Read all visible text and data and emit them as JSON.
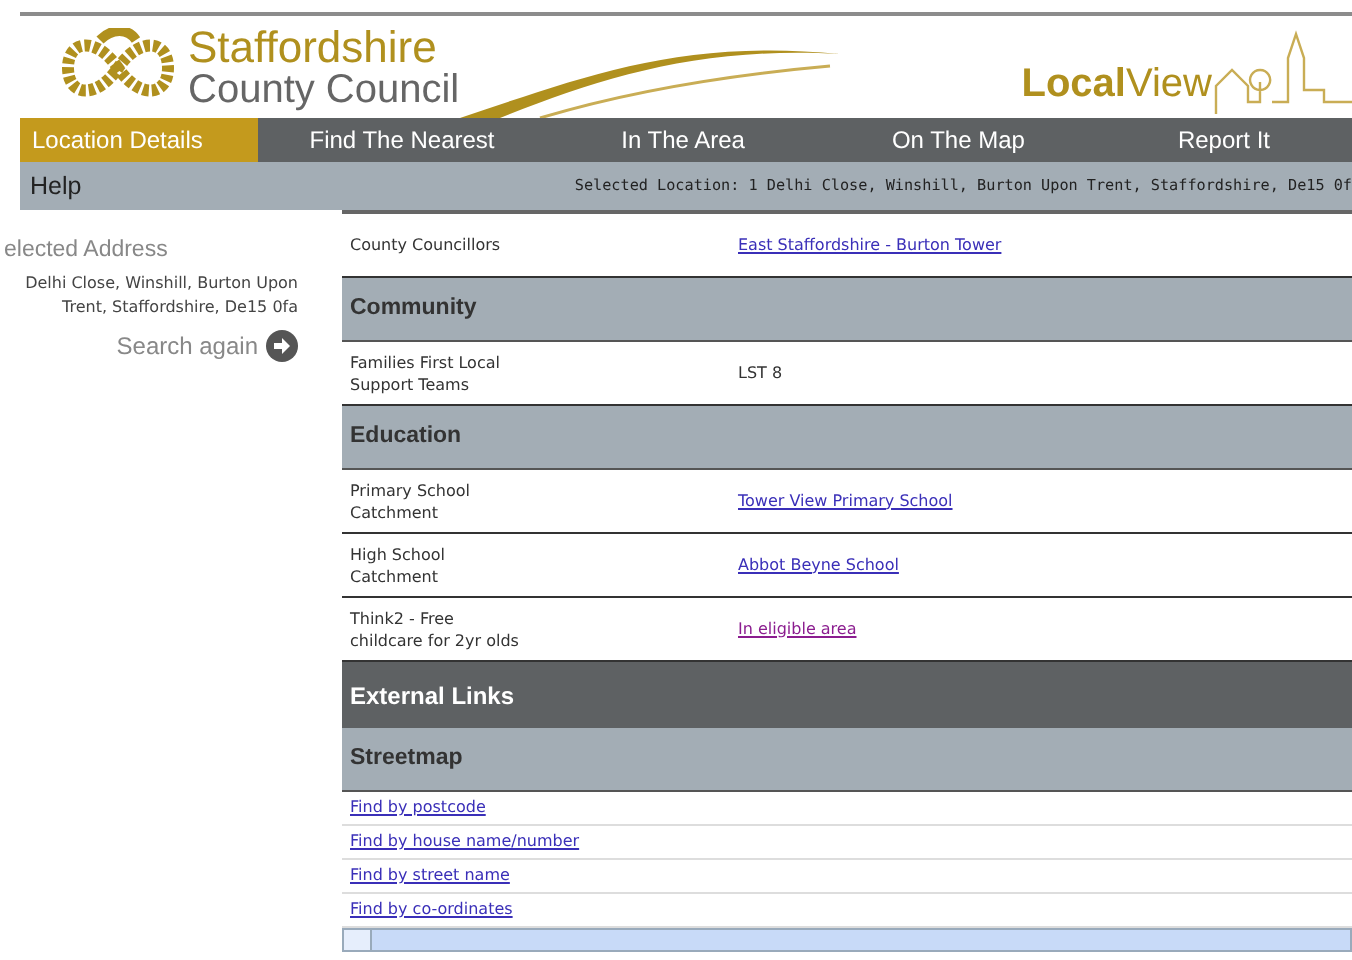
{
  "header": {
    "council_line1": "Staffordshire",
    "council_line2": "County Council",
    "brand_bold": "Local",
    "brand_light": "View"
  },
  "nav": [
    {
      "label": "Location Details",
      "selected": true
    },
    {
      "label": "Find The Nearest",
      "selected": false
    },
    {
      "label": "In The Area",
      "selected": false
    },
    {
      "label": "On The Map",
      "selected": false
    },
    {
      "label": "Report It",
      "selected": false
    }
  ],
  "help": "Help",
  "selected_location": "Selected Location: 1 Delhi Close, Winshill, Burton Upon Trent, Staffordshire, De15 0f",
  "sidebar": {
    "heading": "elected Address",
    "address_line1": "Delhi Close, Winshill, Burton Upon",
    "address_line2": "Trent, Staffordshire, De15 0fa",
    "search_again": "Search again"
  },
  "content": [
    {
      "kind": "row",
      "label": "County Councillors",
      "value": "East Staffordshire - Burton Tower",
      "is_link": true,
      "visited": false
    },
    {
      "kind": "section",
      "title": "Community"
    },
    {
      "kind": "row",
      "label": "Families First Local Support Teams",
      "value": "LST 8",
      "is_link": false
    },
    {
      "kind": "section",
      "title": "Education"
    },
    {
      "kind": "row",
      "label": "Primary School Catchment",
      "value": "Tower View Primary School",
      "is_link": true,
      "visited": false
    },
    {
      "kind": "row",
      "label": "High School Catchment",
      "value": "Abbot Beyne School",
      "is_link": true,
      "visited": false
    },
    {
      "kind": "row",
      "label": "Think2 - Free childcare for 2yr olds",
      "value": "In eligible area",
      "is_link": true,
      "visited": true
    },
    {
      "kind": "major",
      "title": "External Links"
    },
    {
      "kind": "section",
      "title": "Streetmap"
    },
    {
      "kind": "link",
      "label": "Find by postcode"
    },
    {
      "kind": "link",
      "label": "Find by house name/number"
    },
    {
      "kind": "link",
      "label": "Find by street name"
    },
    {
      "kind": "link",
      "label": "Find by co-ordinates"
    }
  ]
}
